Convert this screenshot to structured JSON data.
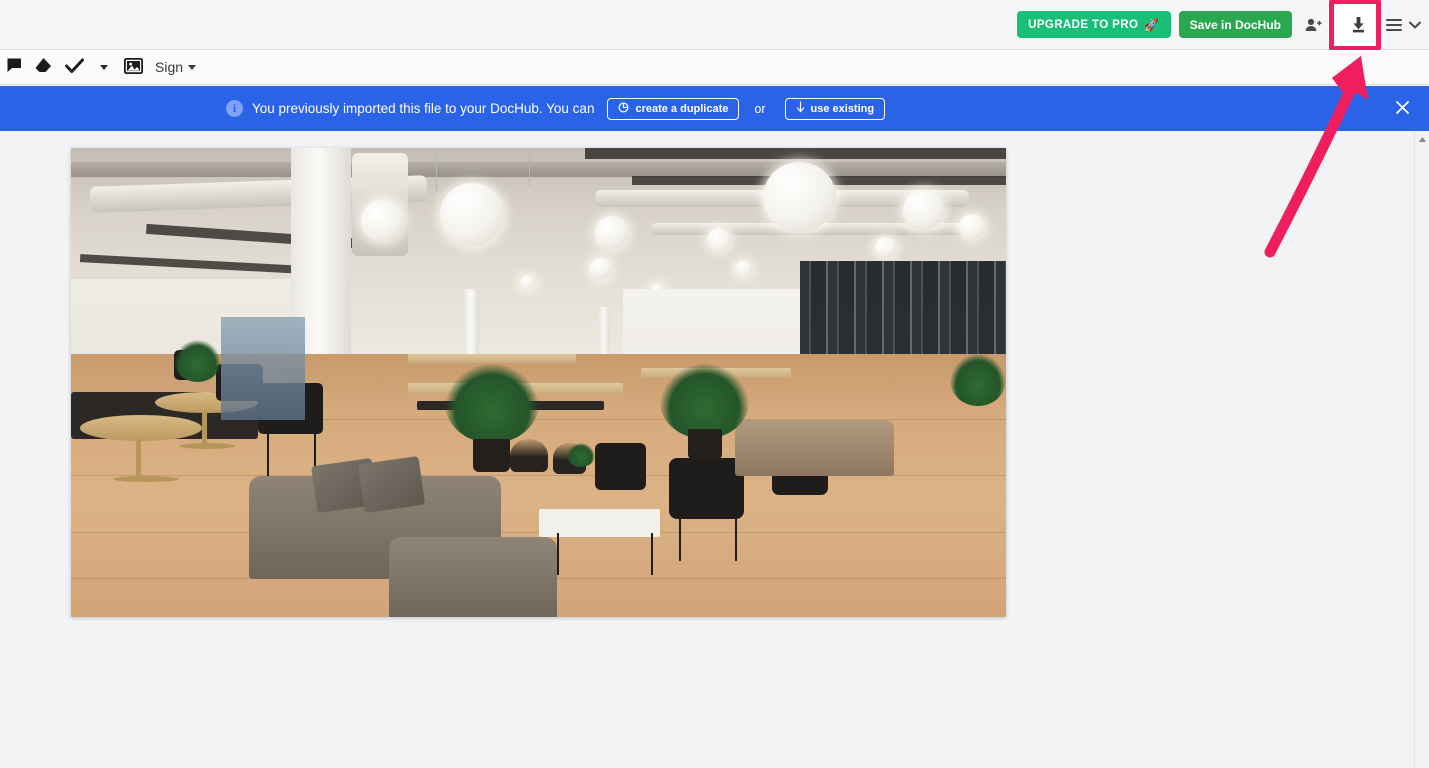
{
  "header": {
    "upgrade_label": "UPGRADE TO PRO",
    "upgrade_icon": "rocket-icon",
    "rocket_glyph": "🚀",
    "save_label": "Save in DocHub",
    "share_icon": "add-person-icon",
    "download_icon": "download-icon",
    "menu_icon": "hamburger-menu-icon",
    "chevron_icon": "chevron-down-icon",
    "upgrade_color": "#18bf76",
    "save_color": "#2aa84f"
  },
  "toolbar": {
    "items": [
      {
        "icon": "comment-icon",
        "label": ""
      },
      {
        "icon": "eraser-icon",
        "label": ""
      },
      {
        "icon": "check-icon",
        "label": ""
      },
      {
        "icon": "chevron-down-icon",
        "label": ""
      },
      {
        "icon": "image-icon",
        "label": ""
      },
      {
        "icon": "sign-dropdown",
        "label": "Sign"
      }
    ],
    "sign_label": "Sign"
  },
  "banner": {
    "icon": "info-icon",
    "info_glyph": "i",
    "message": "You previously imported this file to your DocHub.  You can",
    "duplicate_label": "create a duplicate",
    "duplicate_icon": "duplicate-icon",
    "or_label": "or",
    "use_existing_label": "use existing",
    "use_existing_icon": "arrow-down-icon",
    "close_icon": "close-icon",
    "background_color": "#2a63e8"
  },
  "document": {
    "page_image_alt": "Modern open-plan office interior with exposed ceiling, pendant globe lights, wooden floors, sofas, tables and plants"
  },
  "annotation": {
    "highlight_color": "#ef1f5f",
    "arrow_icon": "pointer-arrow-annotation",
    "target": "download-icon"
  },
  "scrollbar": {
    "up_arrow_icon": "scroll-up-arrow-icon"
  }
}
